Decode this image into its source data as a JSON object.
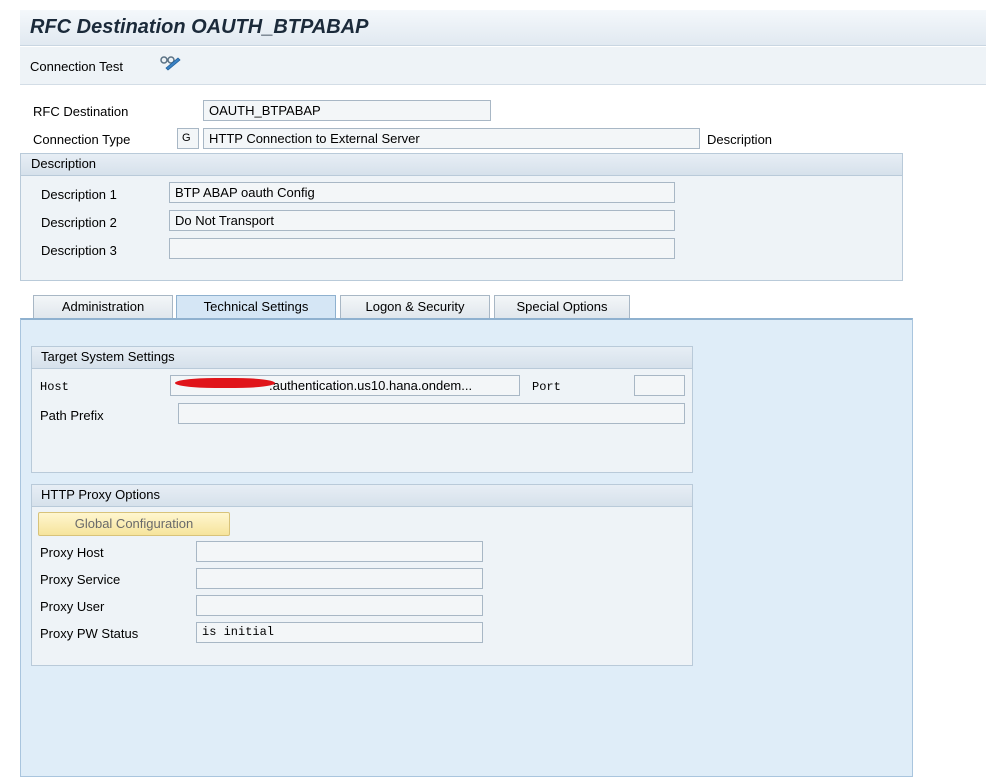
{
  "window": {
    "title": "RFC Destination OAUTH_BTPABAP"
  },
  "toolbar": {
    "connection_test": "Connection Test"
  },
  "header": {
    "rfc_destination_label": "RFC Destination",
    "rfc_destination_value": "OAUTH_BTPABAP",
    "connection_type_label": "Connection Type",
    "connection_type_code": "G",
    "connection_type_value": "HTTP Connection to External Server",
    "description_link": "Description"
  },
  "description_box": {
    "title": "Description",
    "rows": [
      {
        "label": "Description 1",
        "value": "BTP ABAP oauth Config"
      },
      {
        "label": "Description 2",
        "value": "Do Not Transport"
      },
      {
        "label": "Description 3",
        "value": ""
      }
    ]
  },
  "tabs": [
    {
      "label": "Administration",
      "active": false
    },
    {
      "label": "Technical Settings",
      "active": true
    },
    {
      "label": "Logon & Security",
      "active": false
    },
    {
      "label": "Special Options",
      "active": false
    }
  ],
  "target_system": {
    "title": "Target System Settings",
    "host_label": "Host",
    "host_value": ".authentication.us10.hana.ondem...",
    "port_label": "Port",
    "port_value": "",
    "path_prefix_label": "Path Prefix",
    "path_prefix_value": ""
  },
  "proxy": {
    "title": "HTTP Proxy Options",
    "global_config": "Global Configuration",
    "rows": [
      {
        "label": "Proxy Host",
        "value": ""
      },
      {
        "label": "Proxy Service",
        "value": ""
      },
      {
        "label": "Proxy User",
        "value": ""
      },
      {
        "label": "Proxy PW Status",
        "value": "is initial"
      }
    ]
  },
  "colors": {
    "accent": "#d5e6f5",
    "redaction": "#e0141a",
    "button": "#f6e49c"
  }
}
